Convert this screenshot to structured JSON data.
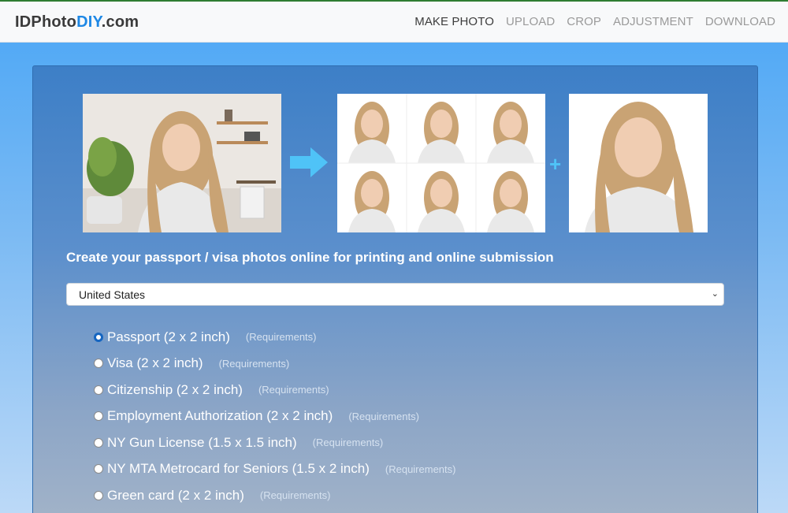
{
  "header": {
    "brand_prefix": "IDPhoto",
    "brand_accent": "DIY",
    "brand_suffix": ".com",
    "nav": [
      "MAKE PHOTO",
      "UPLOAD",
      "CROP",
      "ADJUSTMENT",
      "DOWNLOAD"
    ],
    "active_nav": "MAKE PHOTO"
  },
  "hero": {
    "source_photo": "woman-in-home-office-photo",
    "arrow_icon": "arrow-right-icon",
    "grid_photo": "six-passport-photos-sheet",
    "plus_icon": "+",
    "single_photo": "single-passport-photo"
  },
  "main": {
    "headline": "Create your passport / visa photos online for printing and online submission",
    "country_select": {
      "value": "United States"
    },
    "options": [
      {
        "label": "Passport (2 x 2 inch)",
        "requirements": "(Requirements)",
        "checked": true
      },
      {
        "label": "Visa (2 x 2 inch)",
        "requirements": "(Requirements)",
        "checked": false
      },
      {
        "label": "Citizenship (2 x 2 inch)",
        "requirements": "(Requirements)",
        "checked": false
      },
      {
        "label": "Employment Authorization (2 x 2 inch)",
        "requirements": "(Requirements)",
        "checked": false
      },
      {
        "label": "NY Gun License (1.5 x 1.5 inch)",
        "requirements": "(Requirements)",
        "checked": false
      },
      {
        "label": "NY MTA Metrocard for Seniors (1.5 x 2 inch)",
        "requirements": "(Requirements)",
        "checked": false
      },
      {
        "label": "Green card (2 x 2 inch)",
        "requirements": "(Requirements)",
        "checked": false
      }
    ]
  },
  "colors": {
    "brand_accent": "#1e88e5",
    "arrow": "#4fc3f7",
    "radio_checked": "#1565c0"
  }
}
